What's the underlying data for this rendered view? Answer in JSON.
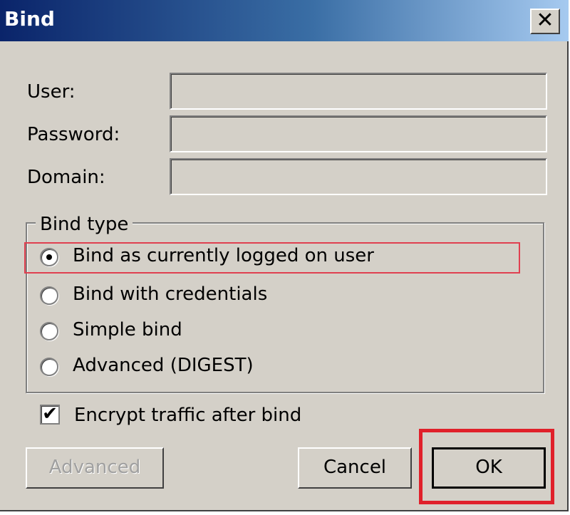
{
  "window": {
    "title": "Bind",
    "close_glyph": "✕"
  },
  "fields": {
    "user": {
      "label": "User:",
      "value": ""
    },
    "password": {
      "label": "Password:",
      "value": ""
    },
    "domain": {
      "label": "Domain:",
      "value": ""
    }
  },
  "bind_type": {
    "legend": "Bind type",
    "options": [
      {
        "label": "Bind as currently logged on user",
        "selected": true
      },
      {
        "label": "Bind with credentials",
        "selected": false
      },
      {
        "label": "Simple bind",
        "selected": false
      },
      {
        "label": "Advanced (DIGEST)",
        "selected": false
      }
    ]
  },
  "encrypt": {
    "label": "Encrypt traffic after bind",
    "checked": true,
    "check_glyph": "✔"
  },
  "buttons": {
    "advanced": "Advanced",
    "cancel": "Cancel",
    "ok": "OK"
  },
  "colors": {
    "highlight": "#e0202a",
    "titlebar_start": "#0a246a",
    "titlebar_end": "#a6caf0"
  }
}
